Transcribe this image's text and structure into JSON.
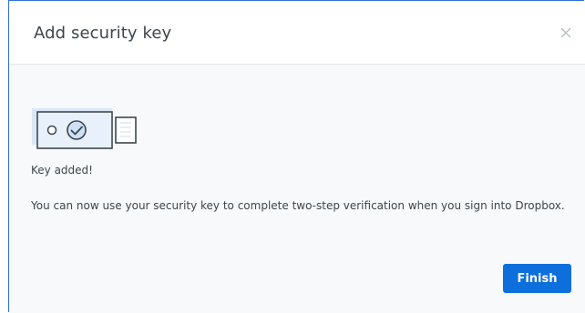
{
  "dialog": {
    "title": "Add security key",
    "close_icon": "close-icon",
    "illustration_icon": "security-key-icon",
    "status_text": "Key added!",
    "message": "You can now use your security key to complete two-step verification when you sign into Dropbox.",
    "finish_label": "Finish"
  },
  "colors": {
    "accent": "#0d6fdc",
    "frame_border": "#2f6fd6",
    "body_background": "#f7f9fa",
    "text": "#3d464d"
  }
}
